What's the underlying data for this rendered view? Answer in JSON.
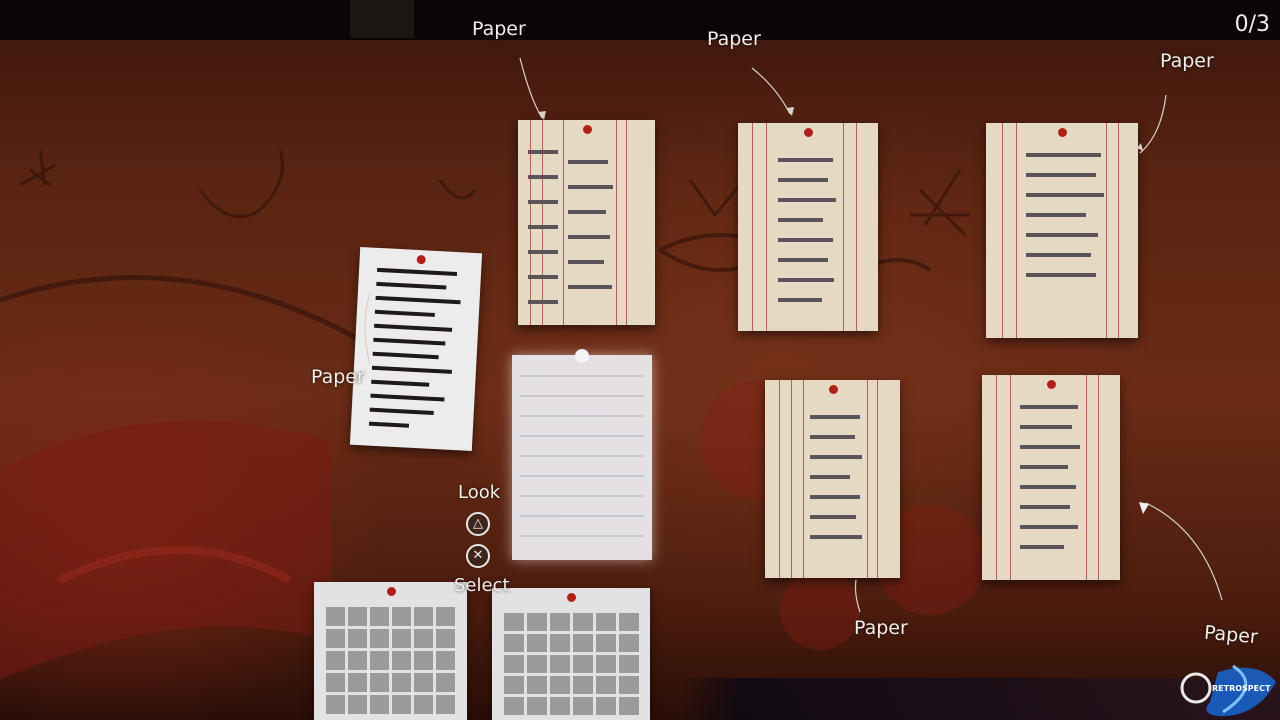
{
  "hud": {
    "counter": "0/3",
    "prompts": {
      "look_label": "Look",
      "look_button_icon": "triangle-icon",
      "select_label": "Select",
      "select_button_icon": "cross-icon"
    }
  },
  "papers": [
    {
      "label": "Paper"
    },
    {
      "label": "Paper"
    },
    {
      "label": "Paper"
    },
    {
      "label": "Paper"
    },
    {
      "label": "Paper"
    },
    {
      "label": "Paper"
    }
  ],
  "watermark": {
    "text": "RETROSPECT"
  },
  "colors": {
    "pin": "#b0201a",
    "wall": "#6a2c16",
    "label": "#f2eeea"
  }
}
